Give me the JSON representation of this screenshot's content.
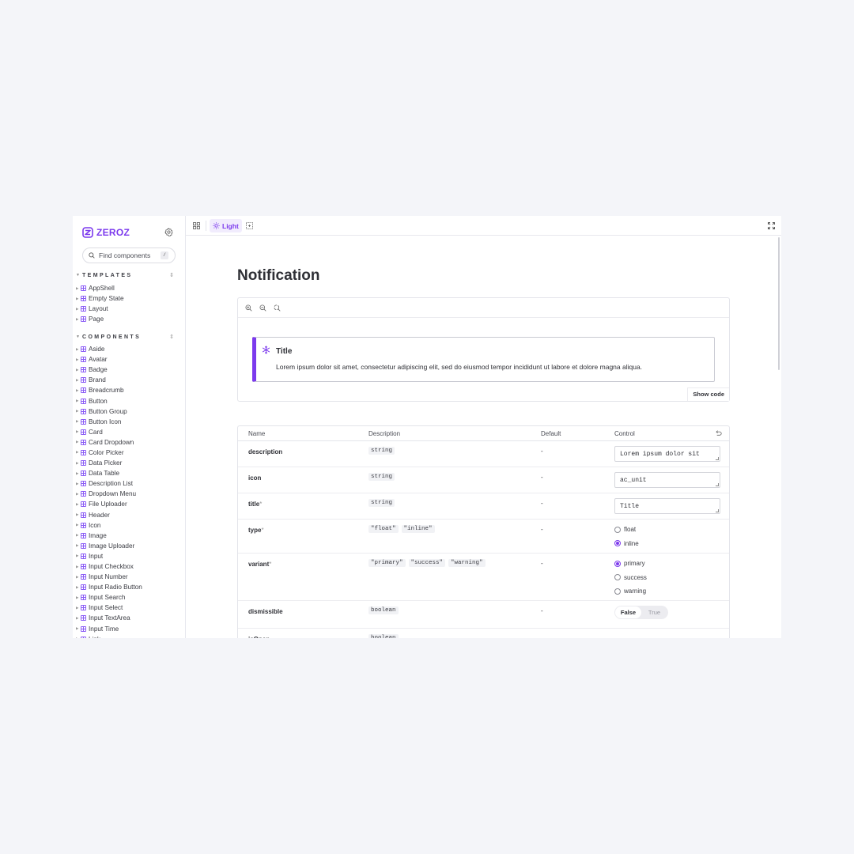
{
  "brand": {
    "name": "ZEROZ",
    "accent": "#7c3aed"
  },
  "search": {
    "placeholder": "Find components",
    "shortcut": "/"
  },
  "sidebar": {
    "templates_title": "TEMPLATES",
    "templates": [
      "AppShell",
      "Empty State",
      "Layout",
      "Page"
    ],
    "components_title": "COMPONENTS",
    "components": [
      "Aside",
      "Avatar",
      "Badge",
      "Brand",
      "Breadcrumb",
      "Button",
      "Button Group",
      "Button Icon",
      "Card",
      "Card Dropdown",
      "Color Picker",
      "Data Picker",
      "Data Table",
      "Description List",
      "Dropdown Menu",
      "File Uploader",
      "Header",
      "Icon",
      "Image",
      "Image Uploader",
      "Input",
      "Input Checkbox",
      "Input Number",
      "Input Radio Button",
      "Input Search",
      "Input Select",
      "Input TextArea",
      "Input Time",
      "Link"
    ]
  },
  "toolbar": {
    "theme_label": "Light"
  },
  "page": {
    "title": "Notification"
  },
  "preview": {
    "notification_title": "Title",
    "notification_description": "Lorem ipsum dolor sit amet, consectetur adipiscing elit, sed do eiusmod tempor incididunt ut labore et dolore magna aliqua.",
    "show_code_label": "Show code"
  },
  "props": {
    "headers": {
      "name": "Name",
      "description": "Description",
      "default": "Default",
      "control": "Control"
    },
    "rows": [
      {
        "name": "description",
        "required": "",
        "types": [
          "string"
        ],
        "default": "-",
        "control_value": "Lorem ipsum dolor sit"
      },
      {
        "name": "icon",
        "required": "",
        "types": [
          "string"
        ],
        "default": "-",
        "control_value": "ac_unit"
      },
      {
        "name": "title",
        "required": "*",
        "types": [
          "string"
        ],
        "default": "-",
        "control_value": "Title"
      },
      {
        "name": "type",
        "required": "*",
        "types": [
          "\"float\"",
          "\"inline\""
        ],
        "default": "-",
        "options": [
          "float",
          "inline"
        ],
        "selected": "inline"
      },
      {
        "name": "variant",
        "required": "*",
        "types": [
          "\"primary\"",
          "\"success\"",
          "\"warning\""
        ],
        "default": "-",
        "options": [
          "primary",
          "success",
          "warning"
        ],
        "selected": "primary"
      },
      {
        "name": "dismissible",
        "required": "",
        "types": [
          "boolean"
        ],
        "default": "-",
        "toggle": [
          "False",
          "True"
        ],
        "selected": "False"
      },
      {
        "name": "isOpen",
        "required": "",
        "types": [
          "boolean"
        ],
        "default": "-"
      }
    ]
  }
}
